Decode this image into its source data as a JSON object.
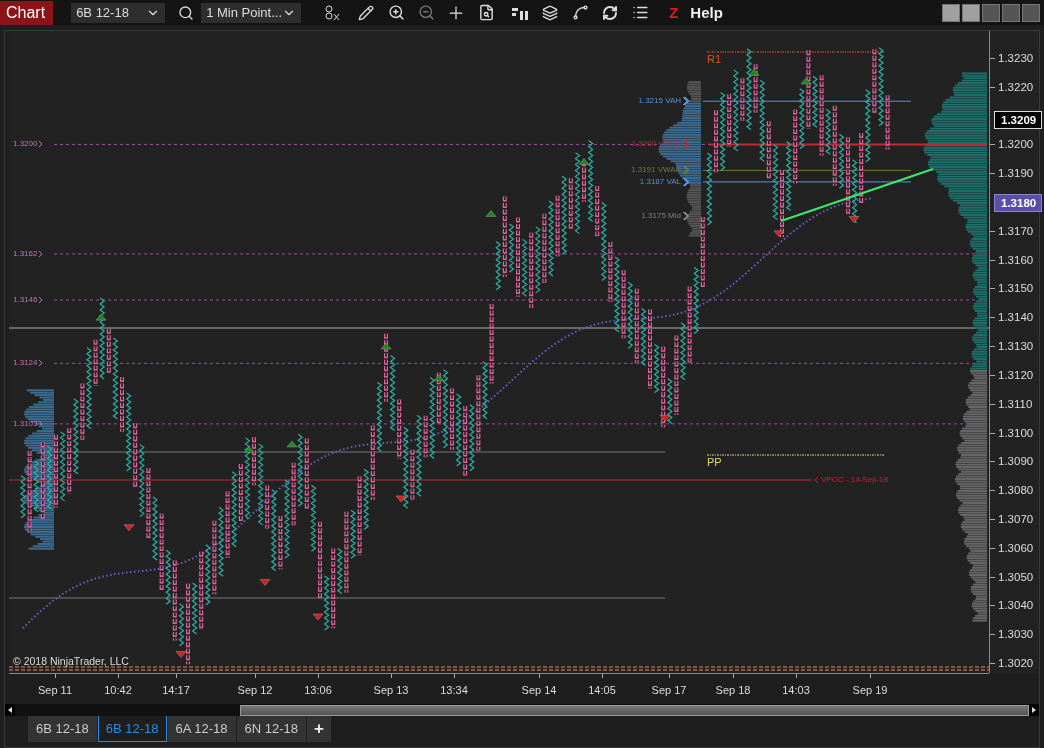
{
  "toolbar": {
    "title": "Chart",
    "instrument": "6B 12-18",
    "period": "1 Min Point...",
    "z_label": "Z",
    "help": "Help"
  },
  "y_axis": {
    "ticks": [
      "1.3230",
      "1.3220",
      "1.3200",
      "1.3190",
      "1.3170",
      "1.3160",
      "1.3150",
      "1.3140",
      "1.3130",
      "1.3120",
      "1.3110",
      "1.3100",
      "1.3090",
      "1.3080",
      "1.3070",
      "1.3060",
      "1.3050",
      "1.3040",
      "1.3030",
      "1.3020"
    ],
    "markers": [
      {
        "label": "1.3209",
        "kind": "last"
      },
      {
        "label": "1.3180",
        "kind": "indicator"
      }
    ]
  },
  "left_levels": [
    "1.3200",
    "1.3162",
    "1.3146",
    "1.3124",
    "1.3103"
  ],
  "profile_levels": [
    {
      "label": "1.3215 VAH",
      "color": "#5b8fd6"
    },
    {
      "label": "1.3200 VPOC",
      "color": "#c0282c"
    },
    {
      "label": "1.3191 VWAP",
      "color": "#6f7a3a"
    },
    {
      "label": "1.3187 VAL",
      "color": "#5b8fd6"
    },
    {
      "label": "1.3175 Mid",
      "color": "#808080"
    }
  ],
  "pivots": [
    {
      "label": "R1",
      "color": "#e0531c"
    },
    {
      "label": "PP",
      "color": "#e6d77a"
    }
  ],
  "naked_vpoc": "VPOC - 14-Sep-18",
  "copyright": "© 2018 NinjaTrader, LLC",
  "x_axis": [
    "Sep 11",
    "10:42",
    "14:17",
    "Sep 12",
    "13:06",
    "Sep 13",
    "13:34",
    "Sep 14",
    "14:05",
    "Sep 17",
    "Sep 18",
    "14:03",
    "Sep 19"
  ],
  "tabs": [
    {
      "label": "6B 12-18",
      "selected": false
    },
    {
      "label": "6B 12-18",
      "selected": true
    },
    {
      "label": "6A 12-18",
      "selected": false
    },
    {
      "label": "6N 12-18",
      "selected": false
    }
  ],
  "add_tab": "+"
}
